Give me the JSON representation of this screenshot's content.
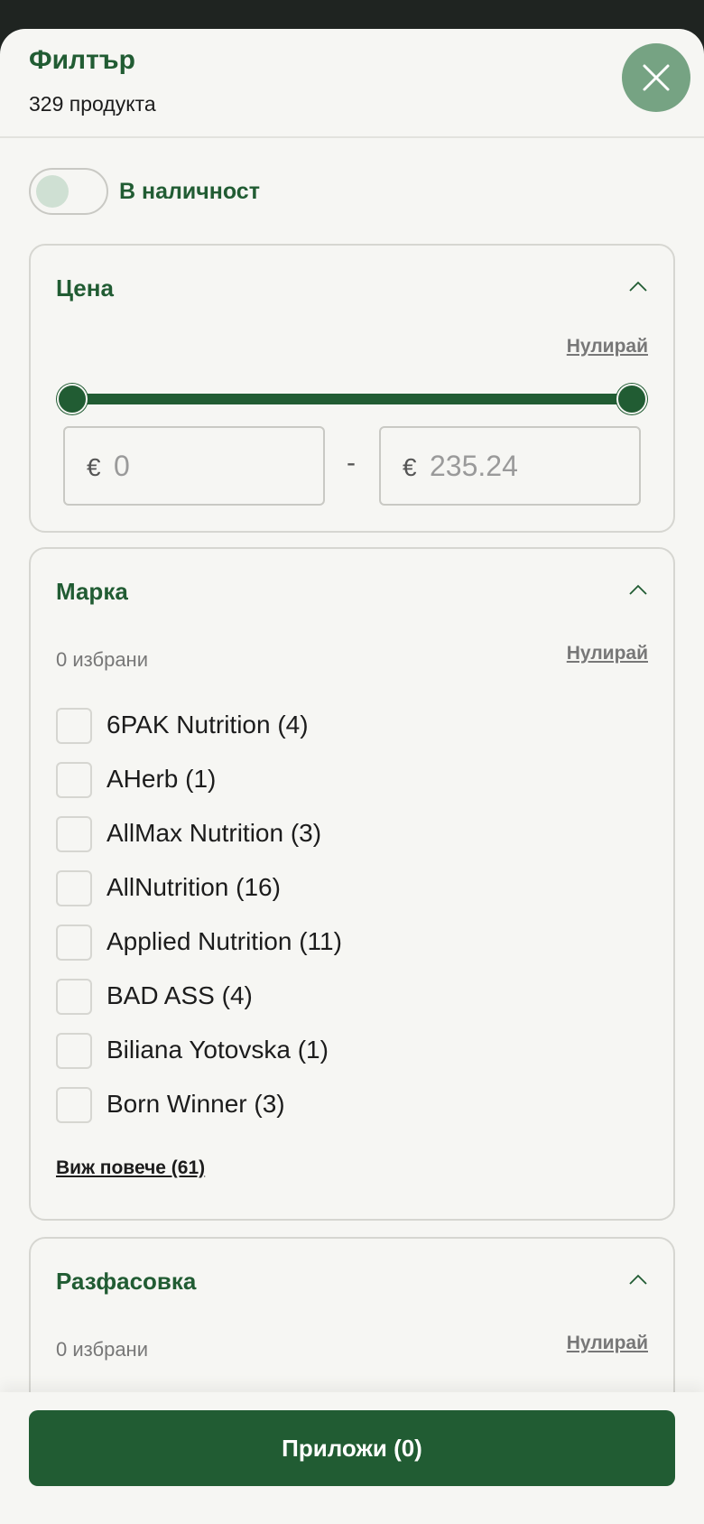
{
  "header": {
    "title": "Филтър",
    "product_count": "329 продукта"
  },
  "stock_toggle": {
    "label": "В наличност",
    "on": false
  },
  "price": {
    "title": "Цена",
    "reset": "Нулирай",
    "currency": "€",
    "min": "0",
    "max": "235.24",
    "separator": "-"
  },
  "brand": {
    "title": "Марка",
    "selected": "0 избрани",
    "reset": "Нулирай",
    "items": [
      {
        "label": "6PAK Nutrition (4)"
      },
      {
        "label": "AHerb (1)"
      },
      {
        "label": "AllMax Nutrition (3)"
      },
      {
        "label": "AllNutrition (16)"
      },
      {
        "label": "Applied Nutrition (11)"
      },
      {
        "label": "BAD ASS (4)"
      },
      {
        "label": "Biliana Yotovska (1)"
      },
      {
        "label": "Born Winner (3)"
      }
    ],
    "see_more": "Виж повече (61)"
  },
  "packaging": {
    "title": "Разфасовка",
    "selected": "0 избрани",
    "reset": "Нулирай"
  },
  "footer": {
    "apply": "Приложи (0)"
  },
  "colors": {
    "brand_green": "#215c33",
    "close_button": "#76a383",
    "background": "#f6f6f3",
    "top_bar": "#1f2421"
  }
}
